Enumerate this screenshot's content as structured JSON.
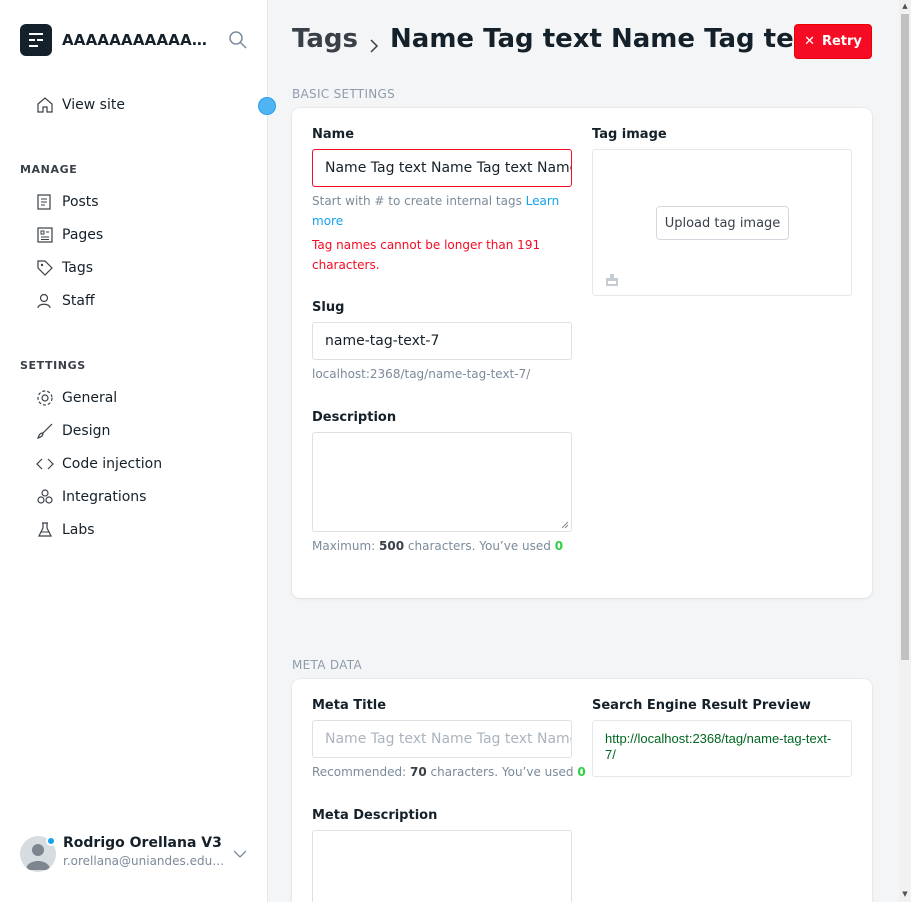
{
  "sidebar": {
    "site_title": "AAAAAAAAAAAAAAAAAAAAAAAAAAAAAAAAAAAAAAAA",
    "view_site": "View site",
    "manage_label": "MANAGE",
    "manage_items": [
      "Posts",
      "Pages",
      "Tags",
      "Staff"
    ],
    "settings_label": "SETTINGS",
    "settings_items": [
      "General",
      "Design",
      "Code injection",
      "Integrations",
      "Labs"
    ],
    "user": {
      "name": "Rodrigo Orellana V3",
      "email": "r.orellana@uniandes.edu.co"
    }
  },
  "header": {
    "breadcrumb": "Tags",
    "title": "Name Tag text Name Tag text",
    "retry_label": "Retry"
  },
  "basic": {
    "group_label": "BASIC SETTINGS",
    "name_label": "Name",
    "name_value": "Name Tag text Name Tag text Name Tag text",
    "name_hint": "Start with # to create internal tags",
    "learn_more": "Learn more",
    "name_error": "Tag names cannot be longer than 191 characters.",
    "slug_label": "Slug",
    "slug_value": "name-tag-text-7",
    "slug_url": "localhost:2368/tag/name-tag-text-7/",
    "description_label": "Description",
    "desc_hint_prefix": "Maximum:",
    "desc_max": "500",
    "desc_hint_mid": "characters. You’ve used",
    "desc_used": "0",
    "tag_image_label": "Tag image",
    "upload_label": "Upload tag image"
  },
  "meta": {
    "group_label": "META DATA",
    "meta_title_label": "Meta Title",
    "meta_title_placeholder": "Name Tag text Name Tag text Name Tag text",
    "meta_hint_prefix": "Recommended:",
    "meta_recommended": "70",
    "meta_hint_mid": "characters. You’ve used",
    "meta_used": "0",
    "meta_description_label": "Meta Description",
    "serp_label": "Search Engine Result Preview",
    "serp_url": "http://localhost:2368/tag/name-tag-text-7/"
  },
  "colors": {
    "accent": "#14a0f0",
    "error": "#f50b23",
    "success": "#30cf43",
    "serp_green": "#006621"
  }
}
